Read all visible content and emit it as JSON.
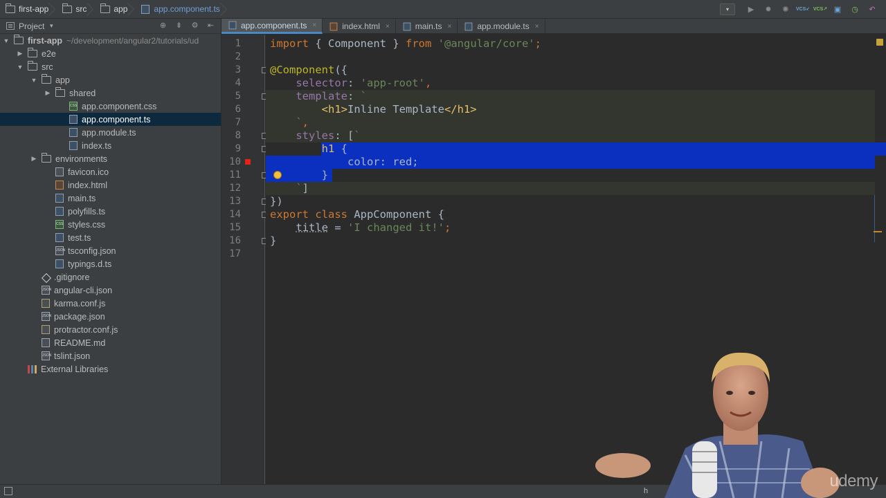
{
  "breadcrumb": [
    "first-app",
    "src",
    "app",
    "app.component.ts"
  ],
  "toolbar": {
    "run_config": "▾",
    "vcs_label": "VCS"
  },
  "project_panel": {
    "title": "Project",
    "tree": [
      {
        "name": "first-app",
        "path": "~/development/angular2/tutorials/ud",
        "type": "folder",
        "depth": 0,
        "expanded": true,
        "bold": true
      },
      {
        "name": "e2e",
        "type": "folder",
        "depth": 1,
        "expanded": false
      },
      {
        "name": "src",
        "type": "folder",
        "depth": 1,
        "expanded": true
      },
      {
        "name": "app",
        "type": "folder",
        "depth": 2,
        "expanded": true
      },
      {
        "name": "shared",
        "type": "folder",
        "depth": 3,
        "expanded": false
      },
      {
        "name": "app.component.css",
        "type": "css",
        "depth": 4
      },
      {
        "name": "app.component.ts",
        "type": "ts",
        "depth": 4,
        "selected": true
      },
      {
        "name": "app.module.ts",
        "type": "ts",
        "depth": 4
      },
      {
        "name": "index.ts",
        "type": "ts",
        "depth": 4
      },
      {
        "name": "environments",
        "type": "folder",
        "depth": 2,
        "expanded": false
      },
      {
        "name": "favicon.ico",
        "type": "ico",
        "depth": 3
      },
      {
        "name": "index.html",
        "type": "html",
        "depth": 3
      },
      {
        "name": "main.ts",
        "type": "ts",
        "depth": 3
      },
      {
        "name": "polyfills.ts",
        "type": "ts",
        "depth": 3
      },
      {
        "name": "styles.css",
        "type": "css",
        "depth": 3
      },
      {
        "name": "test.ts",
        "type": "ts",
        "depth": 3
      },
      {
        "name": "tsconfig.json",
        "type": "json",
        "depth": 3
      },
      {
        "name": "typings.d.ts",
        "type": "ts",
        "depth": 3
      },
      {
        "name": ".gitignore",
        "type": "git",
        "depth": 2
      },
      {
        "name": "angular-cli.json",
        "type": "json",
        "depth": 2
      },
      {
        "name": "karma.conf.js",
        "type": "js",
        "depth": 2
      },
      {
        "name": "package.json",
        "type": "json",
        "depth": 2
      },
      {
        "name": "protractor.conf.js",
        "type": "js",
        "depth": 2
      },
      {
        "name": "README.md",
        "type": "md",
        "depth": 2
      },
      {
        "name": "tslint.json",
        "type": "json",
        "depth": 2
      },
      {
        "name": "External Libraries",
        "type": "lib",
        "depth": 1
      }
    ]
  },
  "tabs": [
    {
      "label": "app.component.ts",
      "type": "ts",
      "active": true
    },
    {
      "label": "index.html",
      "type": "html"
    },
    {
      "label": "main.ts",
      "type": "ts"
    },
    {
      "label": "app.module.ts",
      "type": "ts"
    }
  ],
  "editor": {
    "line_numbers": [
      "1",
      "2",
      "3",
      "4",
      "5",
      "6",
      "7",
      "8",
      "9",
      "10",
      "11",
      "12",
      "13",
      "14",
      "15",
      "16",
      "17"
    ],
    "breakpoint_line": 10,
    "lines": [
      [
        [
          "kw",
          "import"
        ],
        [
          "plain",
          " { Component } "
        ],
        [
          "kw",
          "from"
        ],
        [
          "plain",
          " "
        ],
        [
          "str",
          "'@angular/core'"
        ],
        [
          "kw",
          ";"
        ]
      ],
      [],
      [
        [
          "dec",
          "@Component"
        ],
        [
          "plain",
          "({"
        ]
      ],
      [
        [
          "plain",
          "    "
        ],
        [
          "prop",
          "selector"
        ],
        [
          "plain",
          ": "
        ],
        [
          "str",
          "'app-root'"
        ],
        [
          "kw",
          ","
        ]
      ],
      [
        [
          "plain",
          "    "
        ],
        [
          "prop",
          "template"
        ],
        [
          "plain",
          ": "
        ],
        [
          "str",
          "`"
        ]
      ],
      [
        [
          "plain",
          "        "
        ],
        [
          "tag",
          "<h1>"
        ],
        [
          "plain",
          "Inline Template"
        ],
        [
          "tag",
          "</h1>"
        ]
      ],
      [
        [
          "plain",
          "    "
        ],
        [
          "str",
          "`"
        ],
        [
          "kw",
          ","
        ]
      ],
      [
        [
          "plain",
          "    "
        ],
        [
          "prop",
          "styles"
        ],
        [
          "plain",
          ": ["
        ],
        [
          "str",
          "`"
        ]
      ],
      [
        [
          "plain",
          "        "
        ],
        [
          "sel-tag",
          "h1"
        ],
        [
          "plain",
          " {"
        ]
      ],
      [
        [
          "plain",
          "            color: red;"
        ]
      ],
      [
        [
          "plain",
          "        }"
        ]
      ],
      [
        [
          "plain",
          "    "
        ],
        [
          "str",
          "`"
        ],
        [
          "plain",
          "]"
        ]
      ],
      [
        [
          "plain",
          "})"
        ]
      ],
      [
        [
          "kw",
          "export class"
        ],
        [
          "plain",
          " AppComponent {"
        ]
      ],
      [
        [
          "plain",
          "    "
        ],
        [
          "prop-dotted",
          "title"
        ],
        [
          "plain",
          " = "
        ],
        [
          "str",
          "'I changed it!'"
        ],
        [
          "kw",
          ";"
        ]
      ],
      [
        [
          "plain",
          "}"
        ]
      ],
      []
    ]
  },
  "status": {
    "right_text": "h"
  },
  "watermark": "udemy"
}
